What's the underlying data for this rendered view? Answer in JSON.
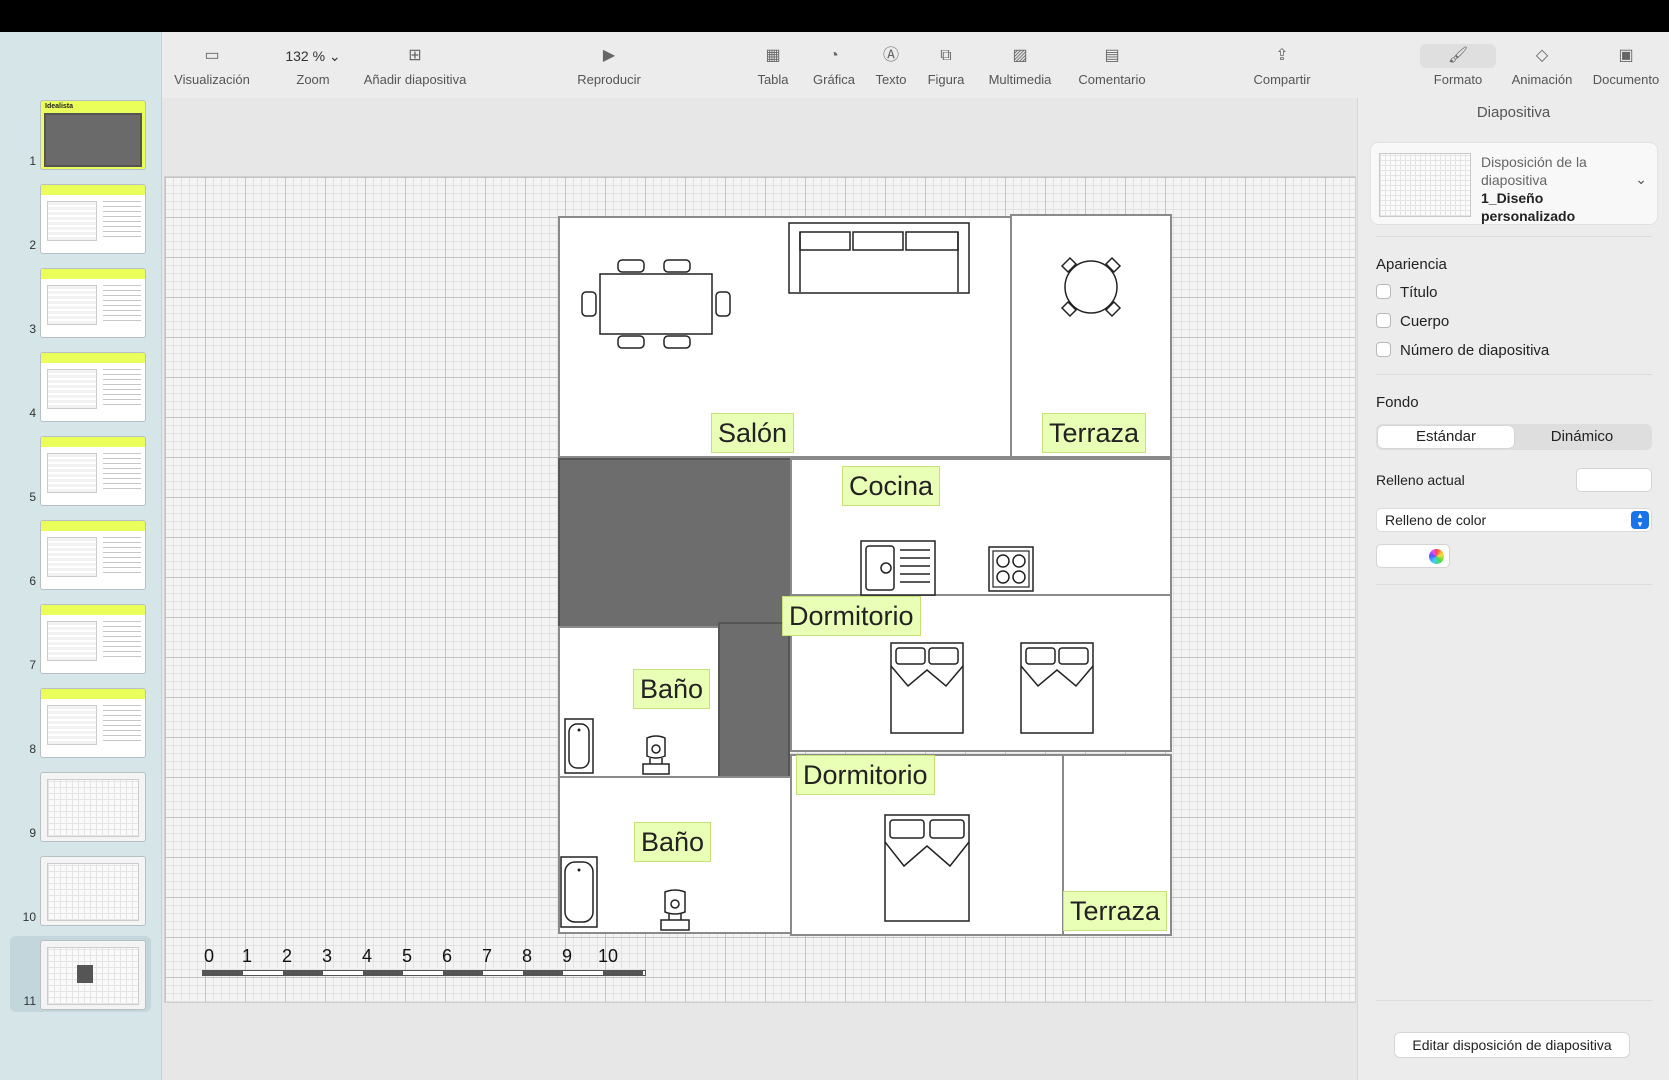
{
  "toolbar": {
    "visualizacion": "Visualización",
    "zoom_value": "132 %",
    "zoom": "Zoom",
    "anadir": "Añadir diapositiva",
    "reproducir": "Reproducir",
    "tabla": "Tabla",
    "grafica": "Gráfica",
    "texto": "Texto",
    "figura": "Figura",
    "multimedia": "Multimedia",
    "comentario": "Comentario",
    "compartir": "Compartir",
    "formato": "Formato",
    "animacion": "Animación",
    "documento": "Documento"
  },
  "slides": {
    "numbers": [
      "1",
      "2",
      "3",
      "4",
      "5",
      "6",
      "7",
      "8",
      "9",
      "10",
      "11"
    ],
    "selected": "11",
    "first_title": "Idealista"
  },
  "floorplan": {
    "rooms": {
      "salon": "Salón",
      "terraza_top": "Terraza",
      "cocina": "Cocina",
      "dormitorio_1": "Dormitorio",
      "bano_1": "Baño",
      "dormitorio_2": "Dormitorio",
      "bano_2": "Baño",
      "terraza_bottom": "Terraza"
    },
    "scale": [
      "0",
      "1",
      "2",
      "3",
      "4",
      "5",
      "6",
      "7",
      "8",
      "9",
      "10"
    ]
  },
  "panel": {
    "title": "Diapositiva",
    "layout_label": "Disposición de la diapositiva",
    "layout_name": "1_Diseño personalizado",
    "apariencia": "Apariencia",
    "titulo": "Título",
    "cuerpo": "Cuerpo",
    "numero": "Número de diapositiva",
    "fondo": "Fondo",
    "estandar": "Estándar",
    "dinamico": "Dinámico",
    "relleno_actual": "Relleno actual",
    "relleno_tipo": "Relleno de color",
    "editar": "Editar disposición de diapositiva"
  },
  "colors": {
    "accent_label": "#eaffb6",
    "thumb_band": "#eaff5a",
    "select_blue": "#1a73e8"
  }
}
